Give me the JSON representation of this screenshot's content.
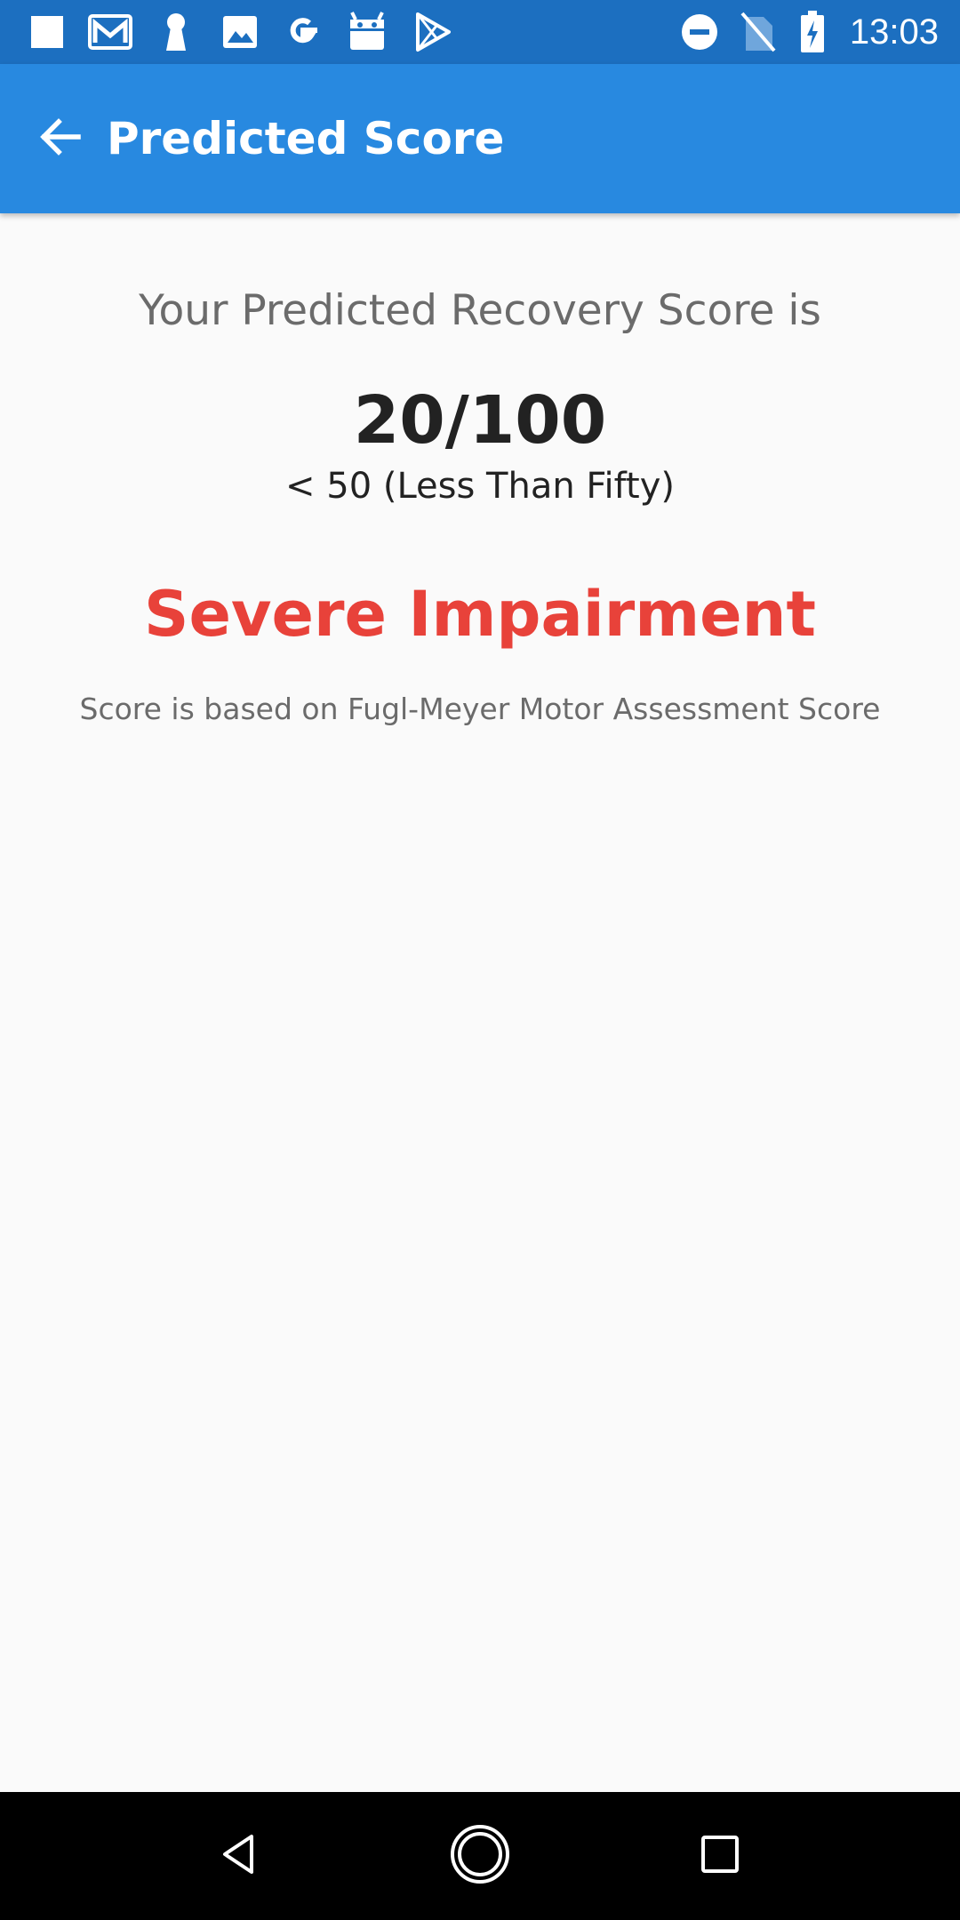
{
  "status_bar": {
    "time": "13:03",
    "left_icons": [
      "notification-square-icon",
      "gmail-icon",
      "keyhole-icon",
      "image-icon",
      "google-icon",
      "android-box-icon",
      "play-store-icon"
    ],
    "right_icons": [
      "do-not-disturb-icon",
      "no-sim-icon",
      "battery-charging-icon"
    ]
  },
  "app_bar": {
    "title": "Predicted Score",
    "back_icon": "arrow-back-icon",
    "color": "#2889e0"
  },
  "result": {
    "headline": "Your Predicted Recovery Score is",
    "score": "20/100",
    "score_description": "< 50 (Less Than Fifty)",
    "severity": "Severe Impairment",
    "severity_color": "#e8423a",
    "basis_note": "Score is based on Fugl-Meyer Motor Assessment Score"
  },
  "nav_bar": {
    "icons": [
      "nav-back-icon",
      "nav-home-icon",
      "nav-recents-icon"
    ]
  }
}
